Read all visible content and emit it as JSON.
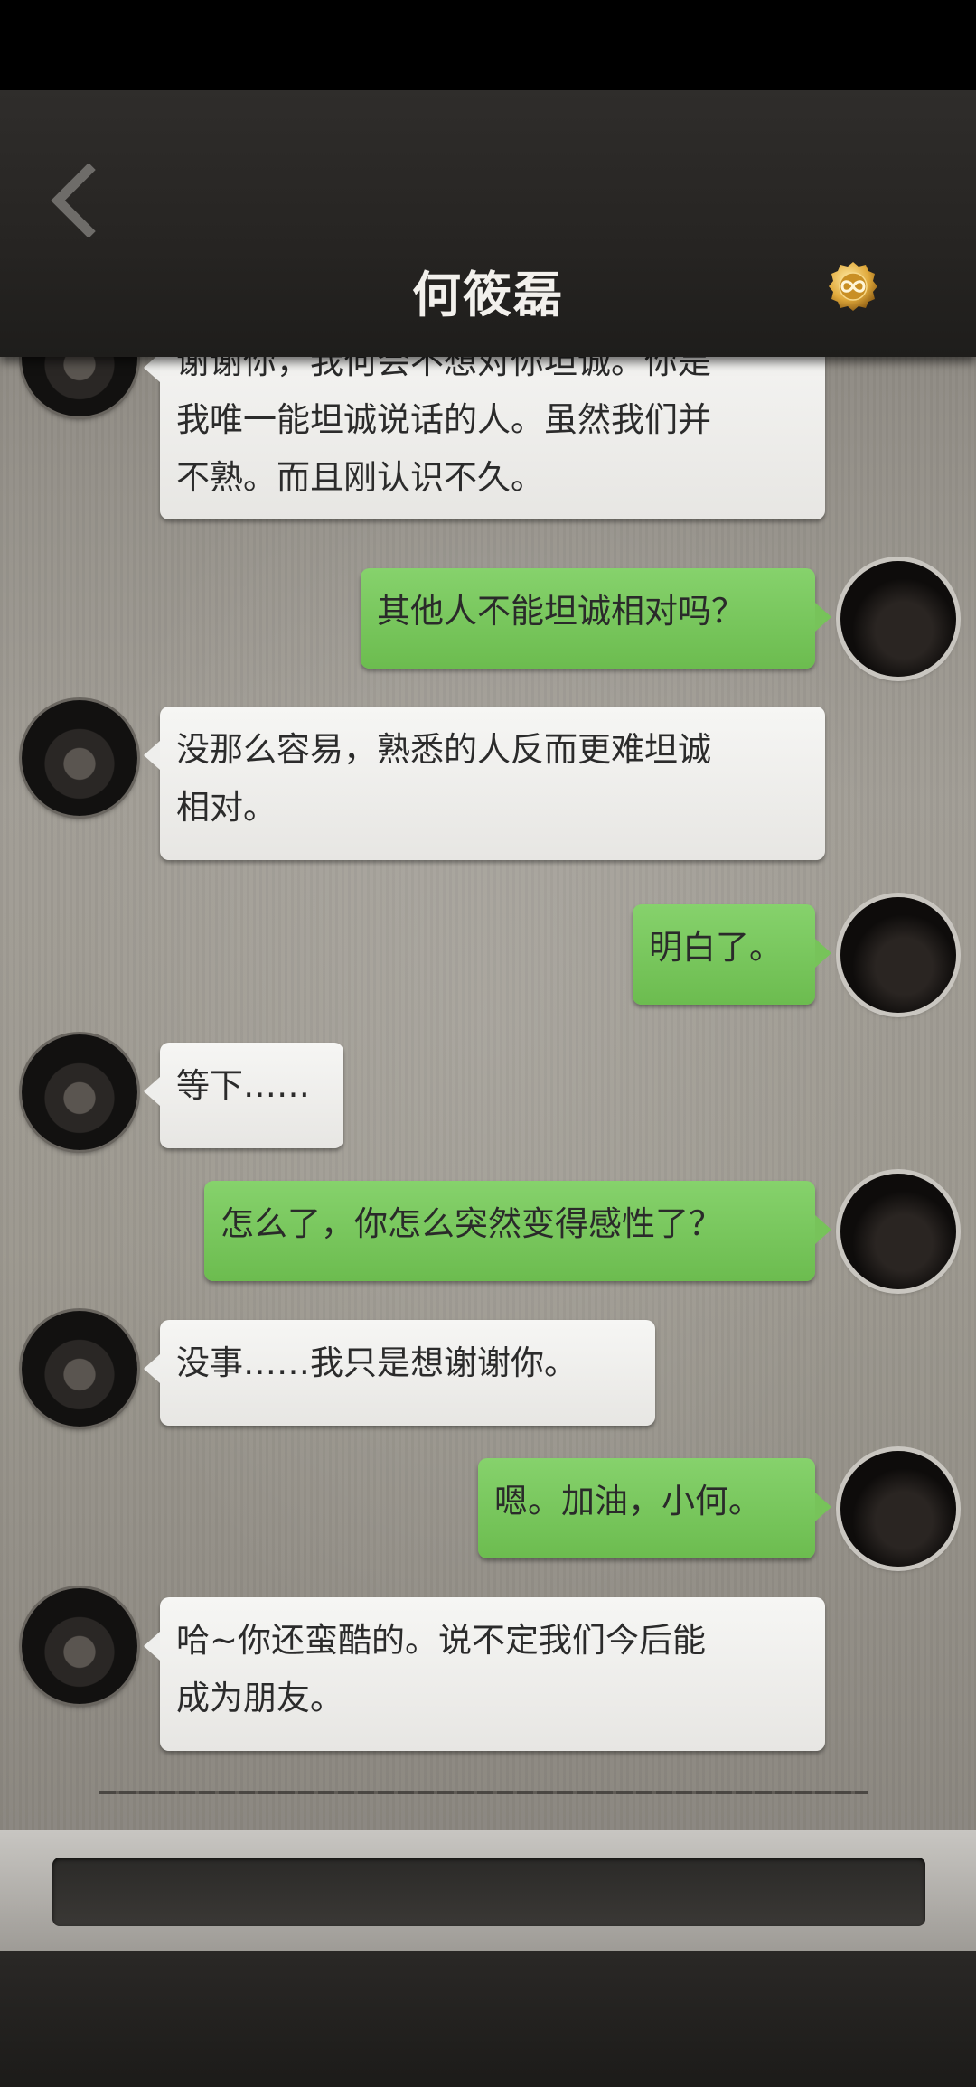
{
  "header": {
    "title": "何筱磊",
    "back_icon": "chevron-left-icon",
    "coin_icon": "infinity-coin-icon"
  },
  "messages": [
    {
      "side": "left",
      "lines": [
        "谢谢你，我何会不想对你坦诚。你是",
        "我唯一能坦诚说话的人。虽然我们并",
        "不熟。而且刚认识不久。"
      ]
    },
    {
      "side": "right",
      "lines": [
        "其他人不能坦诚相对吗？"
      ]
    },
    {
      "side": "left",
      "lines": [
        "没那么容易，熟悉的人反而更难坦诚",
        "相对。"
      ]
    },
    {
      "side": "right",
      "lines": [
        "明白了。"
      ]
    },
    {
      "side": "left",
      "lines": [
        "等下……"
      ]
    },
    {
      "side": "right",
      "lines": [
        "怎么了，你怎么突然变得感性了？"
      ]
    },
    {
      "side": "left",
      "lines": [
        "没事……我只是想谢谢你。"
      ]
    },
    {
      "side": "right",
      "lines": [
        "嗯。加油，小何。"
      ]
    },
    {
      "side": "left",
      "lines": [
        "哈~你还蛮酷的。说不定我们今后能",
        "成为朋友。"
      ]
    }
  ],
  "input": {
    "placeholder": ""
  }
}
